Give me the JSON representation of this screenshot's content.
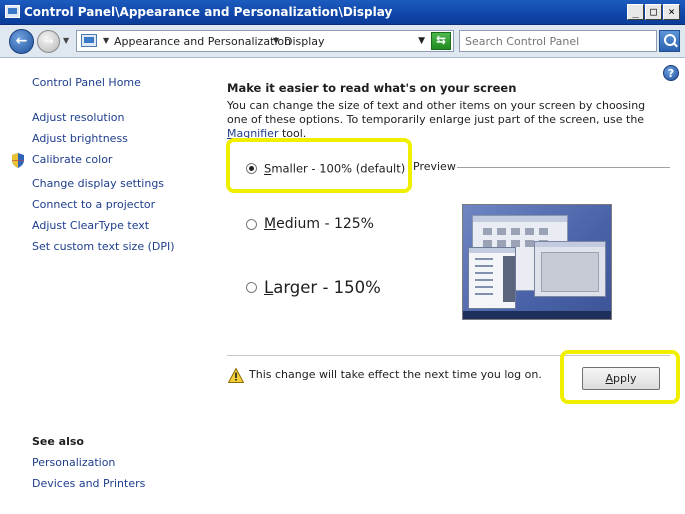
{
  "window": {
    "title": "Control Panel\\Appearance and Personalization\\Display",
    "minimize": "_",
    "maximize": "□",
    "close": "×"
  },
  "address": {
    "crumb1": "Appearance and Personalization",
    "crumb2": "Display",
    "search_placeholder": "Search Control Panel"
  },
  "sidebar": {
    "home": "Control Panel Home",
    "links": [
      "Adjust resolution",
      "Adjust brightness",
      "Calibrate color",
      "Change display settings",
      "Connect to a projector",
      "Adjust ClearType text",
      "Set custom text size (DPI)"
    ],
    "see_also_heading": "See also",
    "see_also": [
      "Personalization",
      "Devices and Printers"
    ]
  },
  "main": {
    "heading": "Make it easier to read what's on your screen",
    "desc_before": "You can change the size of text and other items on your screen by choosing one of these options. To temporarily enlarge just part of the screen, use the ",
    "desc_link": "Magnifier",
    "desc_after": " tool.",
    "options": [
      {
        "ul": "S",
        "rest": "maller - 100% (default)",
        "checked": true
      },
      {
        "ul": "M",
        "rest": "edium - 125%",
        "checked": false
      },
      {
        "ul": "L",
        "rest": "arger - 150%",
        "checked": false
      }
    ],
    "preview_label": "Preview",
    "warning_text": "This change will take effect the next time you log on.",
    "apply_ul": "A",
    "apply_rest": "pply"
  },
  "colors": {
    "highlight": "#f0ef00",
    "link": "#1e3e8c"
  }
}
